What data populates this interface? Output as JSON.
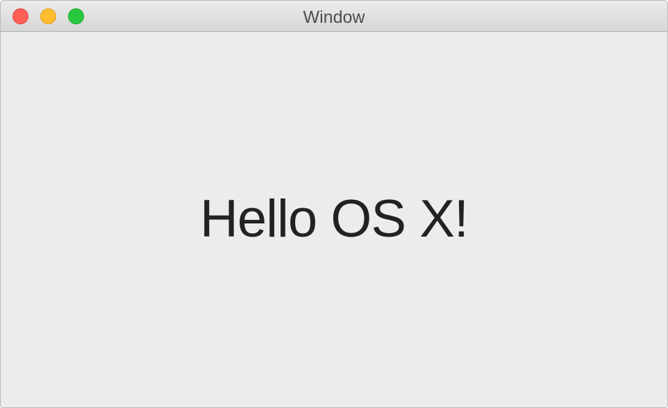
{
  "window": {
    "title": "Window",
    "traffic_lights": [
      {
        "name": "close-button",
        "color": "#fe5f57"
      },
      {
        "name": "minimize-button",
        "color": "#febc2e"
      },
      {
        "name": "zoom-button",
        "color": "#28c840"
      }
    ]
  },
  "content": {
    "label": "Hello OS X!"
  }
}
